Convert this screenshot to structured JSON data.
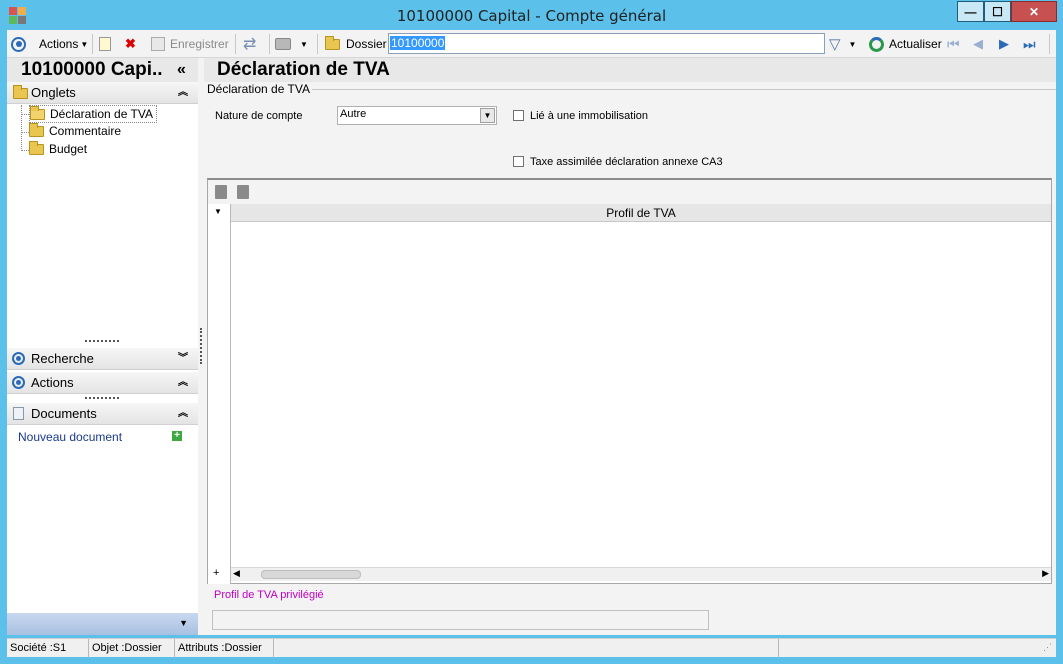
{
  "window": {
    "title": "10100000 Capital -  Compte général"
  },
  "toolbar": {
    "actions_label": "Actions",
    "save_label": "Enregistrer",
    "dossier_label": "Dossier",
    "dossier_value": "10100000",
    "refresh_label": "Actualiser"
  },
  "sidebar": {
    "title": "10100000 Capi..",
    "collapse_glyph": "«",
    "tabs_header": "Onglets",
    "tabs": [
      {
        "label": "Déclaration de TVA"
      },
      {
        "label": "Commentaire"
      },
      {
        "label": "Budget"
      }
    ],
    "search_header": "Recherche",
    "actions_header": "Actions",
    "documents_header": "Documents",
    "new_document_label": "Nouveau document"
  },
  "main": {
    "title": "Déclaration de TVA",
    "group_label": "Déclaration de TVA",
    "nature_label": "Nature de compte",
    "nature_value": "Autre",
    "immobilisation_label": "Lié à une immobilisation",
    "immobilisation_checked": false,
    "taxe_label": "Taxe assimilée déclaration annexe CA3",
    "taxe_checked": false,
    "grid_column": "Profil de TVA",
    "profil_privilegie_label": "Profil de TVA privilégié",
    "profil_privilegie_value": ""
  },
  "status": {
    "societe": "Société :S1",
    "objet": "Objet :Dossier",
    "attributs": "Attributs :Dossier"
  },
  "colors": {
    "frame": "#5bc0ea",
    "accent": "#2a6ab8",
    "pink_label": "#c000c0",
    "close_button": "#c75050"
  }
}
